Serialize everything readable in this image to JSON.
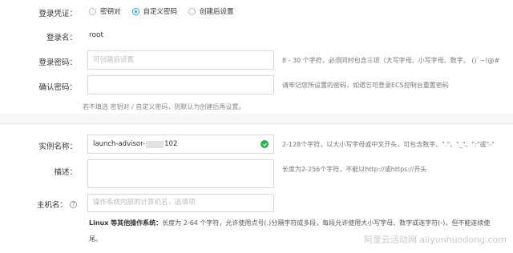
{
  "credential": {
    "label": "登录凭证：",
    "options": [
      {
        "label": "密钥对",
        "selected": false
      },
      {
        "label": "自定义密码",
        "selected": true
      },
      {
        "label": "创建后设置",
        "selected": false
      }
    ]
  },
  "login_name": {
    "label": "登录名：",
    "value": "root"
  },
  "password": {
    "label": "登录密码：",
    "placeholder": "可创建后设置",
    "hint": "8 - 30 个字符，必须同时包含三项（大写字母、小写字母、数字、 ()`~!@#"
  },
  "confirm_password": {
    "label": "确认密码：",
    "hint": "请牢记您所设置的密码，如遗忘可登录ECS控制台重置密码"
  },
  "credential_note": "若不填选 密钥对 / 自定义密码，则默认为创建后再设置。",
  "instance_name": {
    "label": "实例名称：",
    "value_prefix": "launch-advisor-",
    "value_suffix": "102",
    "hint": "2-128个字符，以大小写字母或中文开头，可包含数字、\".\"、\"_\"、\":\"或\"-\""
  },
  "description": {
    "label": "描述：",
    "hint": "长度为2-256个字符，不能以http://或https://开头"
  },
  "hostname": {
    "label": "主机名：",
    "help_glyph": "?",
    "placeholder": "操作系统内部的计算机名，选填项",
    "rule_title": "Linux 等其他操作系统：",
    "rule_text": "长度为 2-64 个字符，允许使用点号(.)分隔字符成多段，每段允许使用大小写字母、数字或连字符(-)，但不能连续使",
    "rule_text_2": "尾。"
  },
  "watermark": "阿里云活动网 aliyunhuodong.com",
  "colors": {
    "accent": "#1fa2ff",
    "success": "#2bb24c"
  }
}
